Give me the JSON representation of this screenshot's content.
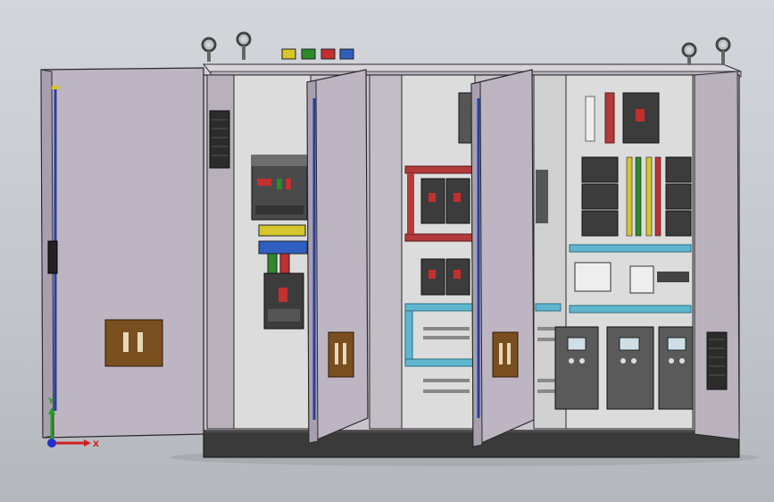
{
  "scene": {
    "description_free": true,
    "background": {
      "top": "#d3d6da",
      "bottom": "#b4b7bc"
    },
    "colors": {
      "cabinet_body": "#c9c3cc",
      "cabinet_edge": "#2a2a2a",
      "door_panel": "#bdb5c2",
      "door_shade": "#a79fae",
      "plinth": "#3a3a3a",
      "backplate": "#d8d8d8",
      "busbar_red": "#b23a3a",
      "cable_tray_cyan": "#5fb7cf",
      "breaker_dark": "#3c3c3c",
      "vfd_body": "#5a5a5a",
      "door_lock": "#7a4f1f",
      "handle_rod": "#2b3fa0",
      "term_green": "#2c8a2c",
      "term_yellow": "#d7c52c",
      "term_red": "#c23030",
      "term_blue": "#2f5fc0"
    },
    "icons": {
      "lifting_eye": "lifting-eye-icon",
      "axis_triad": "axis-triad-icon",
      "door_lock": "door-lock-icon",
      "vent_grille": "vent-grille-icon"
    },
    "top_terminals": [
      "yellow",
      "green",
      "red",
      "blue"
    ],
    "vfd_count": 3,
    "axis_triad": {
      "x_label": "X",
      "y_label": "Y",
      "x_color": "#d02020",
      "y_color": "#20a020",
      "z_color": "#2030d0"
    }
  }
}
